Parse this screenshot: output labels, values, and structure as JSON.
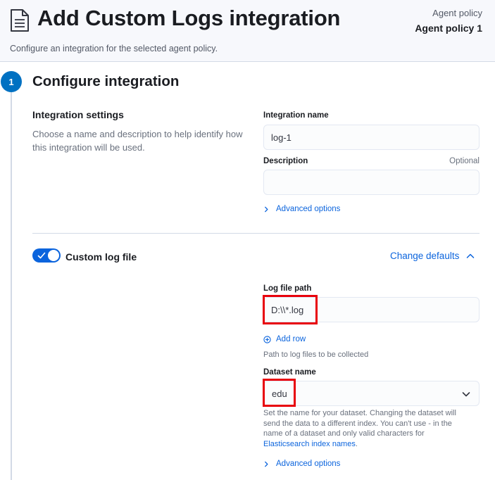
{
  "header": {
    "title": "Add Custom Logs integration",
    "subtitle": "Configure an integration for the selected agent policy.",
    "policy_label": "Agent policy",
    "policy_name": "Agent policy 1",
    "icon": "document-icon"
  },
  "step": {
    "number": "1",
    "title": "Configure integration"
  },
  "integration_settings": {
    "title": "Integration settings",
    "description": "Choose a name and description to help identify how this integration will be used.",
    "name_label": "Integration name",
    "name_value": "log-1",
    "description_label": "Description",
    "description_optional": "Optional",
    "description_value": "",
    "advanced_options": "Advanced options"
  },
  "custom_log": {
    "toggle_label": "Custom log file",
    "enabled": true,
    "change_defaults": "Change defaults",
    "log_path_label": "Log file path",
    "log_path_value": "D:\\\\*.log",
    "add_row": "Add row",
    "log_path_help": "Path to log files to be collected",
    "dataset_label": "Dataset name",
    "dataset_value": "edu",
    "dataset_help_line1": "Set the name for your dataset. Changing the dataset will",
    "dataset_help_line2": "send the data to a different index. You can't use - in the",
    "dataset_help_line3": "name of a dataset and only valid characters for",
    "dataset_help_link": "Elasticsearch index names",
    "dataset_help_end": ".",
    "advanced_options": "Advanced options"
  },
  "colors": {
    "accent": "#0b64dd",
    "step_badge": "#0071c2",
    "highlight": "#e8000b"
  }
}
